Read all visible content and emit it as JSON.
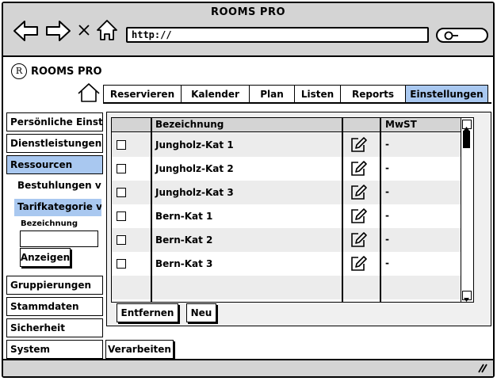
{
  "window": {
    "title": "ROOMS PRO"
  },
  "browser": {
    "url": "http://"
  },
  "app": {
    "logo_letter": "R",
    "name": "ROOMS PRO"
  },
  "tabs": [
    {
      "label": "Reservieren",
      "active": false
    },
    {
      "label": "Kalender",
      "active": false
    },
    {
      "label": "Plan",
      "active": false
    },
    {
      "label": "Listen",
      "active": false
    },
    {
      "label": "Reports",
      "active": false
    },
    {
      "label": "Einstellungen",
      "active": true
    }
  ],
  "sidebar": {
    "items": [
      {
        "label": "Persönliche Einstel"
      },
      {
        "label": "Dienstleistungen"
      },
      {
        "label": "Ressourcen",
        "active": true
      },
      {
        "label": "Gruppierungen"
      },
      {
        "label": "Stammdaten"
      },
      {
        "label": "Sicherheit"
      },
      {
        "label": "System"
      }
    ],
    "sub_items": [
      {
        "label": "Bestuhlungen ver"
      },
      {
        "label": "Tarifkategorie ve",
        "active": true
      }
    ],
    "field_label": "Bezeichnung",
    "field_value": "",
    "show_button": "Anzeigen"
  },
  "table": {
    "headers": {
      "name": "Bezeichnung",
      "mwst": "MwST"
    },
    "rows": [
      {
        "name": "Jungholz-Kat 1",
        "mwst": "-"
      },
      {
        "name": "Jungholz-Kat 2",
        "mwst": "-"
      },
      {
        "name": "Jungholz-Kat 3",
        "mwst": "-"
      },
      {
        "name": "Bern-Kat 1",
        "mwst": "-"
      },
      {
        "name": "Bern-Kat 2",
        "mwst": "-"
      },
      {
        "name": "Bern-Kat 3",
        "mwst": "-"
      }
    ]
  },
  "buttons": {
    "remove": "Entfernen",
    "new": "Neu",
    "process": "Verarbeiten"
  },
  "colors": {
    "active_tab": "#a9c8f0",
    "chrome": "#d4d4d4"
  },
  "icons": [
    "back-arrow-icon",
    "forward-arrow-icon",
    "close-icon",
    "home-icon",
    "search-icon",
    "edit-icon",
    "resize-grip-icon"
  ]
}
